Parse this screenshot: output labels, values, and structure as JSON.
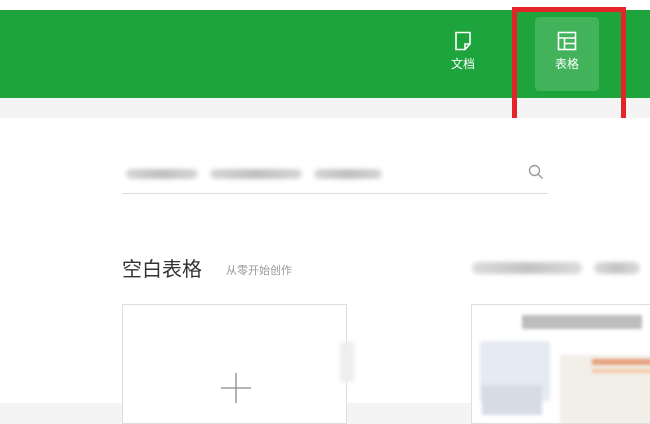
{
  "header": {
    "color": "#1ea43c",
    "nav": [
      {
        "label": "文档",
        "icon": "document-icon"
      },
      {
        "label": "表格",
        "icon": "table-icon",
        "active": true
      }
    ]
  },
  "highlight": {
    "color": "#e3242b"
  },
  "search": {
    "icon": "search-icon"
  },
  "section": {
    "title": "空白表格",
    "subtitle": "从零开始创作"
  },
  "blank_card": {
    "icon": "plus-icon"
  }
}
